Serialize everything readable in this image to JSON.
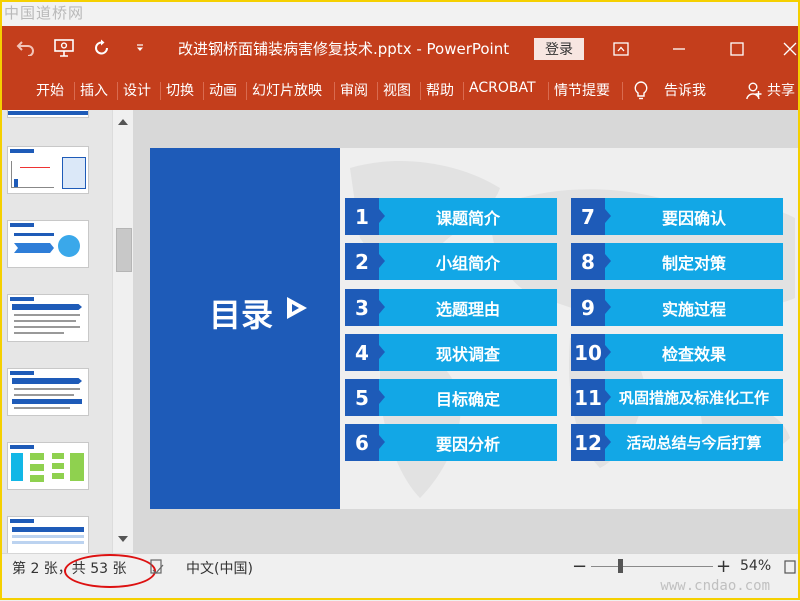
{
  "watermarks": {
    "top": "中国道桥网",
    "bottom": "www.cndao.com"
  },
  "titlebar": {
    "document_title": "改进钢桥面铺装病害修复技术.pptx  -  PowerPoint",
    "signin_label": "登录",
    "qat_icons": [
      "undo-icon",
      "present-from-start-icon",
      "redo-icon",
      "customize-qat-icon"
    ],
    "window_icons": [
      "ribbon-display-options-icon",
      "minimize-icon",
      "maximize-icon",
      "close-icon"
    ]
  },
  "ribbon": {
    "tabs": [
      "开始",
      "插入",
      "设计",
      "切换",
      "动画",
      "幻灯片放映",
      "审阅",
      "视图",
      "帮助",
      "ACROBAT",
      "情节提要"
    ],
    "tell_me": "告诉我",
    "share": "共享"
  },
  "slide": {
    "heading": "目录",
    "items": [
      {
        "num": "1",
        "label": "课题简介"
      },
      {
        "num": "2",
        "label": "小组简介"
      },
      {
        "num": "3",
        "label": "选题理由"
      },
      {
        "num": "4",
        "label": "现状调查"
      },
      {
        "num": "5",
        "label": "目标确定"
      },
      {
        "num": "6",
        "label": "要因分析"
      },
      {
        "num": "7",
        "label": "要因确认"
      },
      {
        "num": "8",
        "label": "制定对策"
      },
      {
        "num": "9",
        "label": "实施过程"
      },
      {
        "num": "10",
        "label": "检查效果"
      },
      {
        "num": "11",
        "label": "巩固措施及标准化工作"
      },
      {
        "num": "12",
        "label": "活动总结与今后打算"
      }
    ]
  },
  "statusbar": {
    "slide_position": "第 2 张，共 53 张",
    "language": "中文(中国)",
    "zoom_out": "−",
    "zoom_in": "+",
    "zoom_percent": "54%"
  },
  "colors": {
    "ribbon": "#c43e1c",
    "slide_blue": "#1e5bb8",
    "item_cyan": "#12a7e6",
    "annotation_red": "#d11111"
  }
}
